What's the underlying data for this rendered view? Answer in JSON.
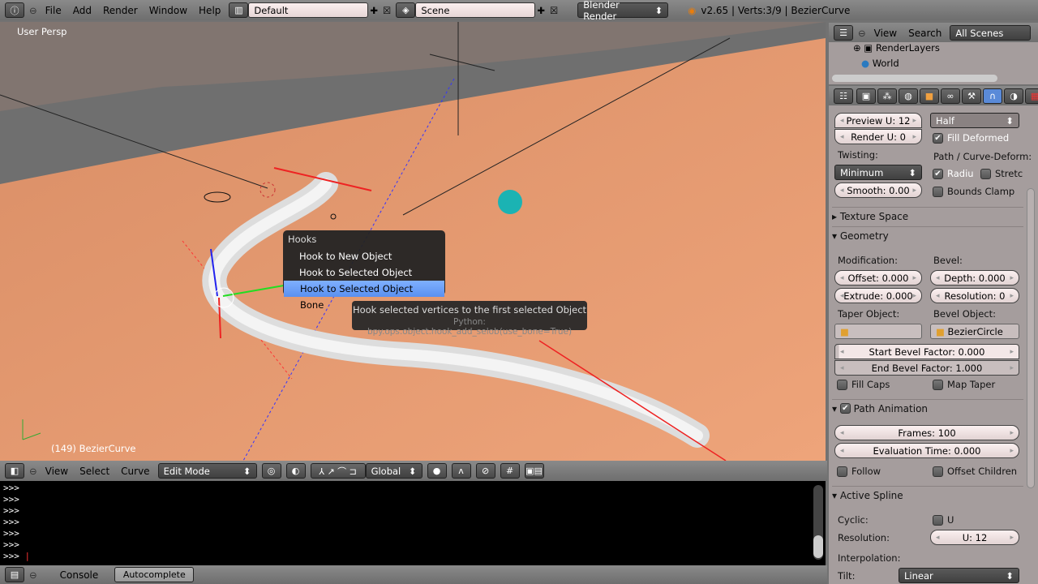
{
  "topbar": {
    "menus": [
      "File",
      "Add",
      "Render",
      "Window",
      "Help"
    ],
    "layout": "Default",
    "scene": "Scene",
    "engine": "Blender Render",
    "info": "v2.65 | Verts:3/9 | BezierCurve"
  },
  "viewport": {
    "view_label": "User Persp",
    "object_label": "(149) BezierCurve",
    "bg_color": "#e39a6f"
  },
  "hooks_menu": {
    "title": "Hooks",
    "items": [
      "Hook to New Object",
      "Hook to Selected Object",
      "Hook to Selected Object Bone"
    ],
    "highlighted": 2
  },
  "tooltip": {
    "text": "Hook selected vertices to the first selected Object",
    "python": "Python: bpy.ops.object.hook_add_selob(use_bone=True)"
  },
  "view3d_header": {
    "menus": [
      "View",
      "Select",
      "Curve"
    ],
    "mode": "Edit Mode",
    "orientation": "Global"
  },
  "console": {
    "lines": [
      ">>>",
      ">>>",
      ">>>",
      ">>>",
      ">>>",
      ">>>",
      ">>>"
    ],
    "tabs": [
      "Console",
      "Autocomplete"
    ]
  },
  "outliner": {
    "menus": [
      "View",
      "Search"
    ],
    "filter": "All Scenes",
    "items": [
      "RenderLayers",
      "World"
    ]
  },
  "properties": {
    "preview_u": "Preview U: 12",
    "render_u": "Render U: 0",
    "fill": "Half",
    "fill_deformed": "Fill Deformed",
    "twisting_label": "Twisting:",
    "twisting": "Minimum",
    "smooth": "Smooth: 0.00",
    "path_deform_label": "Path / Curve-Deform:",
    "radius": "Radiu",
    "stretch": "Stretc",
    "bounds_clamp": "Bounds Clamp",
    "texture_space": "Texture Space",
    "geometry": "Geometry",
    "modification_label": "Modification:",
    "bevel_label": "Bevel:",
    "offset": "Offset: 0.000",
    "depth": "Depth: 0.000",
    "extrude": "Extrude: 0.000",
    "resolution": "Resolution: 0",
    "taper_label": "Taper Object:",
    "bevel_obj_label": "Bevel Object:",
    "bevel_object": "BezierCircle",
    "start_bevel": "Start Bevel Factor: 0.000",
    "end_bevel": "End Bevel Factor: 1.000",
    "fill_caps": "Fill Caps",
    "map_taper": "Map Taper",
    "path_animation": "Path Animation",
    "frames": "Frames: 100",
    "eval_time": "Evaluation Time: 0.000",
    "follow": "Follow",
    "offset_children": "Offset Children",
    "active_spline": "Active Spline",
    "cyclic_label": "Cyclic:",
    "cyclic_u": "U",
    "resolution_label": "Resolution:",
    "res_u": "U: 12",
    "interpolation_label": "Interpolation:",
    "tilt_label": "Tilt:",
    "tilt": "Linear"
  }
}
